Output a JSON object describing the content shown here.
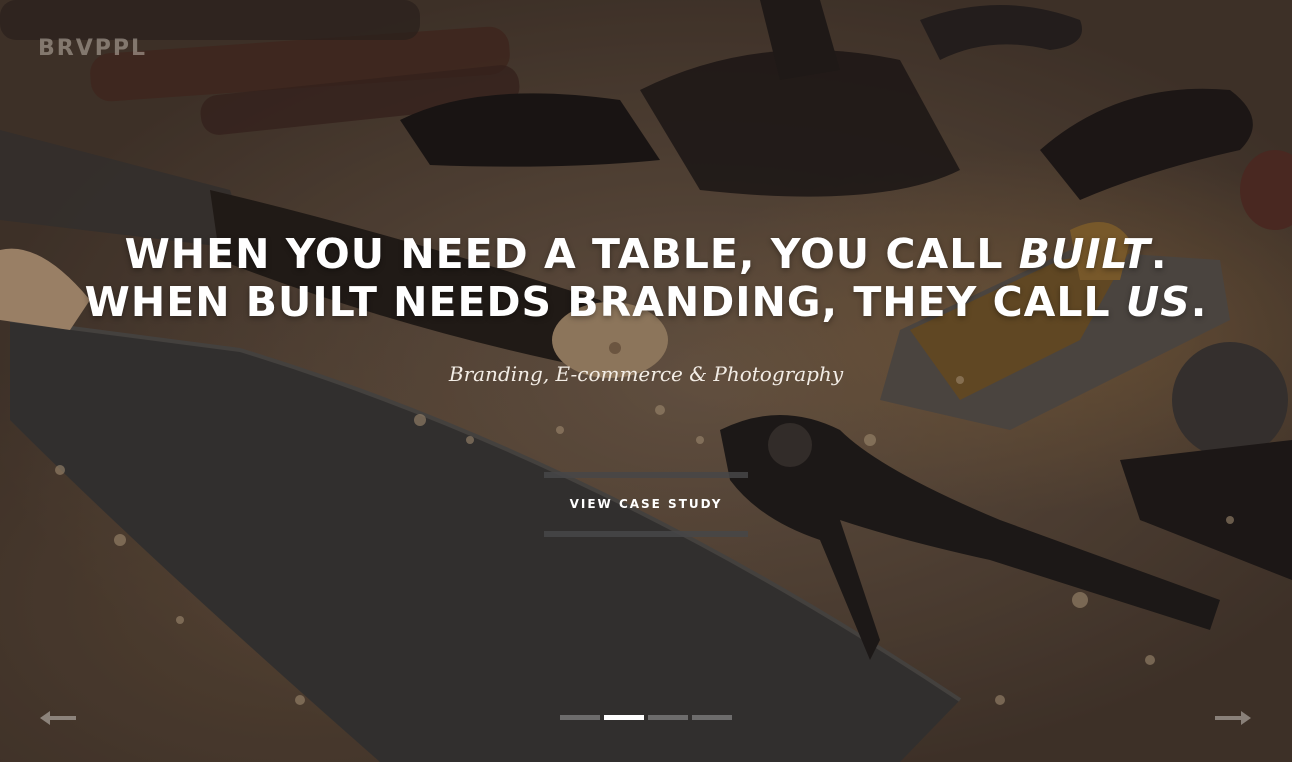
{
  "brand": {
    "logo_text": "BRVPPL"
  },
  "hero": {
    "headline_line1_prefix": "WHEN YOU NEED A TABLE, YOU CALL ",
    "headline_line1_emph": "BUILT",
    "headline_line1_suffix": ".",
    "headline_line2_prefix": "WHEN BUILT NEEDS BRANDING, THEY CALL ",
    "headline_line2_emph": "US",
    "headline_line2_suffix": ".",
    "subtitle": "Branding, E-commerce & Photography",
    "cta_label": "VIEW CASE STUDY"
  },
  "slider": {
    "prev_icon": "arrow-left-icon",
    "next_icon": "arrow-right-icon",
    "slide_count": 4,
    "active_slide_index": 1
  },
  "colors": {
    "headline": "#ffffff",
    "dot_active": "#ffffff",
    "dot_inactive": "#969696",
    "cta_rule": "#464648"
  }
}
